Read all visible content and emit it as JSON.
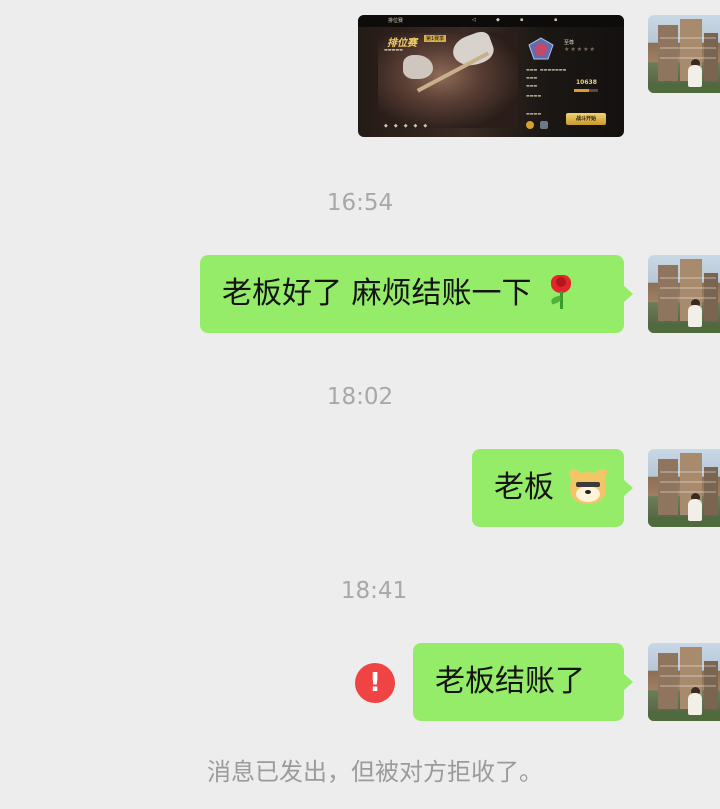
{
  "chat": {
    "messages": [
      {
        "type": "image",
        "image_label": "game-screenshot",
        "game": {
          "title": "排位赛",
          "season": "第1赛季",
          "rank": "至尊",
          "points": "10638",
          "start_button": "战斗开始",
          "topbar_left": "排位赛"
        }
      },
      {
        "type": "time",
        "text": "16:54"
      },
      {
        "type": "text",
        "text": "老板好了 麻烦结账一下",
        "emoji": "rose-icon"
      },
      {
        "type": "time",
        "text": "18:02"
      },
      {
        "type": "text",
        "text": "老板",
        "emoji": "dog-icon"
      },
      {
        "type": "time",
        "text": "18:41"
      },
      {
        "type": "text",
        "text": "老板结账了",
        "status": "failed"
      }
    ],
    "system_notice": "消息已发出，但被对方拒收了。"
  },
  "colors": {
    "background": "#ededed",
    "bubble_green": "#95ec69",
    "error_red": "#f04343",
    "time_gray": "#a8a8a8"
  }
}
